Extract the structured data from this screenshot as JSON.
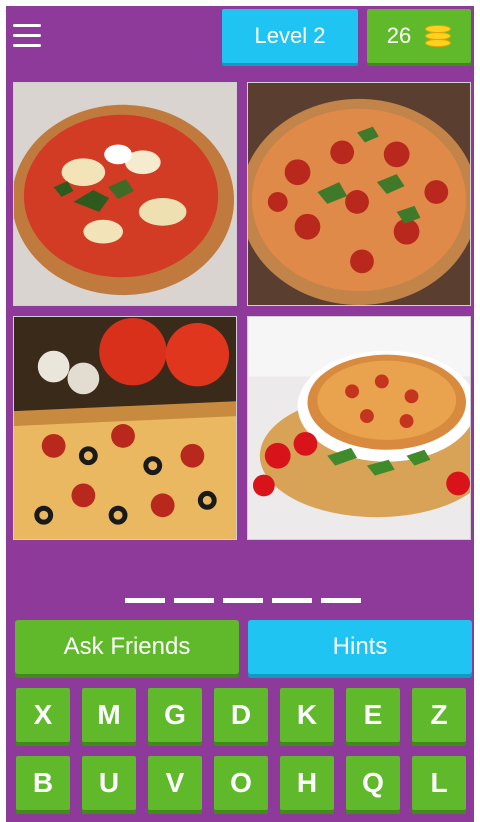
{
  "header": {
    "level_label": "Level 2",
    "coins": "26"
  },
  "images": [
    {
      "name": "pizza-image-1"
    },
    {
      "name": "pizza-image-2"
    },
    {
      "name": "pizza-image-3"
    },
    {
      "name": "pizza-image-4"
    }
  ],
  "answer_slots": 5,
  "buttons": {
    "ask_friends": "Ask Friends",
    "hints": "Hints"
  },
  "keyboard": {
    "row1": [
      "X",
      "M",
      "G",
      "D",
      "K",
      "E",
      "Z"
    ],
    "row2": [
      "B",
      "U",
      "V",
      "O",
      "H",
      "Q",
      "L"
    ]
  },
  "colors": {
    "background": "#8e3a9a",
    "green": "#5fb92b",
    "blue": "#1fc4f2"
  },
  "icons": [
    "menu-icon",
    "coins-icon"
  ]
}
